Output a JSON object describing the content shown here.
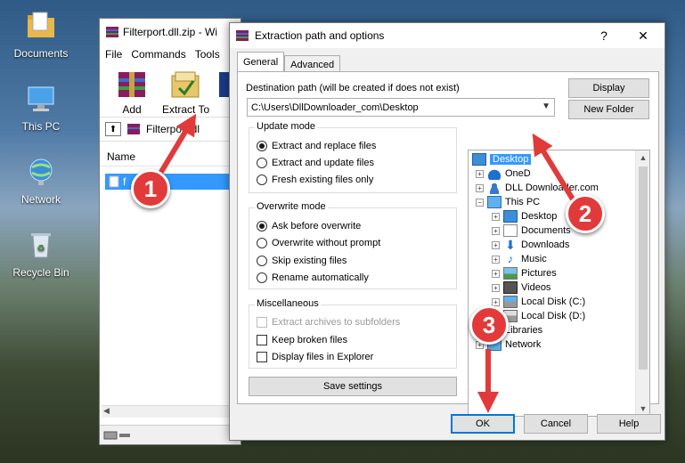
{
  "desktop": {
    "icons": [
      {
        "label": "Documents"
      },
      {
        "label": "This PC"
      },
      {
        "label": "Network"
      },
      {
        "label": "Recycle Bin"
      }
    ]
  },
  "winrar": {
    "title": "Filterport.dll.zip - Wi",
    "menu": [
      "File",
      "Commands",
      "Tools"
    ],
    "toolbar": [
      "Add",
      "Extract To"
    ],
    "path": "Filterport.dl",
    "column_name": "Name",
    "file": "f      .dll"
  },
  "dialog": {
    "title": "Extraction path and options",
    "help_label": "?",
    "close_label": "✕",
    "tabs": [
      "General",
      "Advanced"
    ],
    "destination_label": "Destination path (will be created if does not exist)",
    "destination_value": "C:\\Users\\DllDownloader_com\\Desktop",
    "display_button": "Display",
    "new_folder_button": "New Folder",
    "update_mode": {
      "title": "Update mode",
      "options": [
        "Extract and replace files",
        "Extract and update files",
        "Fresh existing files only"
      ]
    },
    "overwrite_mode": {
      "title": "Overwrite mode",
      "options": [
        "Ask before overwrite",
        "Overwrite without prompt",
        "Skip existing files",
        "Rename automatically"
      ]
    },
    "misc": {
      "title": "Miscellaneous",
      "options": [
        "Extract archives to subfolders",
        "Keep broken files",
        "Display files in Explorer"
      ]
    },
    "save_settings": "Save settings",
    "tree": [
      "Desktop",
      "OneD",
      "DLL Downloader.com",
      "This PC",
      "Desktop",
      "Documents",
      "Downloads",
      "Music",
      "Pictures",
      "Videos",
      "Local Disk (C:)",
      "Local Disk (D:)",
      "Libraries",
      "Network"
    ],
    "ok": "OK",
    "cancel": "Cancel",
    "help": "Help"
  },
  "callouts": [
    "1",
    "2",
    "3"
  ],
  "colors": {
    "accent": "#0078d7",
    "callout": "#e23a3a",
    "selection": "#3399ff"
  }
}
